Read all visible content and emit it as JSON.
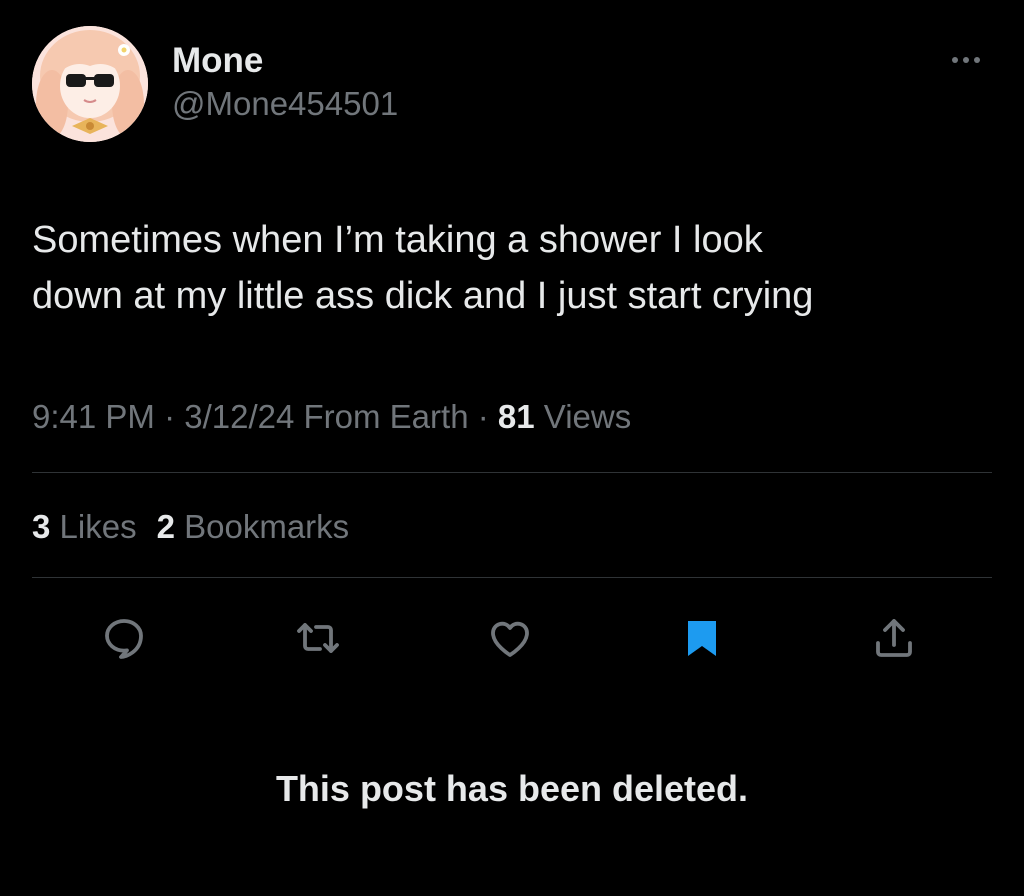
{
  "author": {
    "display_name": "Mone",
    "handle": "@Mone454501"
  },
  "post": {
    "text_lines": [
      "Sometimes when I’m taking a shower I look",
      "down at my little ass dick and I just start crying"
    ],
    "time": "9:41 PM",
    "sep1": " · ",
    "date": "3/12/24",
    "source": "From Earth",
    "sep2": " · ",
    "views_count": "81",
    "views_label": "Views"
  },
  "stats": {
    "likes_count": "3",
    "likes_label": "Likes",
    "bookmarks_count": "2",
    "bookmarks_label": "Bookmarks"
  },
  "actions": [
    {
      "icon": "reply-icon"
    },
    {
      "icon": "repost-icon"
    },
    {
      "icon": "like-icon"
    },
    {
      "icon": "bookmark-icon",
      "active": true
    },
    {
      "icon": "share-icon"
    }
  ],
  "colors": {
    "background": "#000000",
    "primary_text": "#e7e9ea",
    "secondary_text": "#71767b",
    "divider": "#2f3336",
    "accent": "#1d9bf0"
  },
  "notice": "This post has been deleted."
}
